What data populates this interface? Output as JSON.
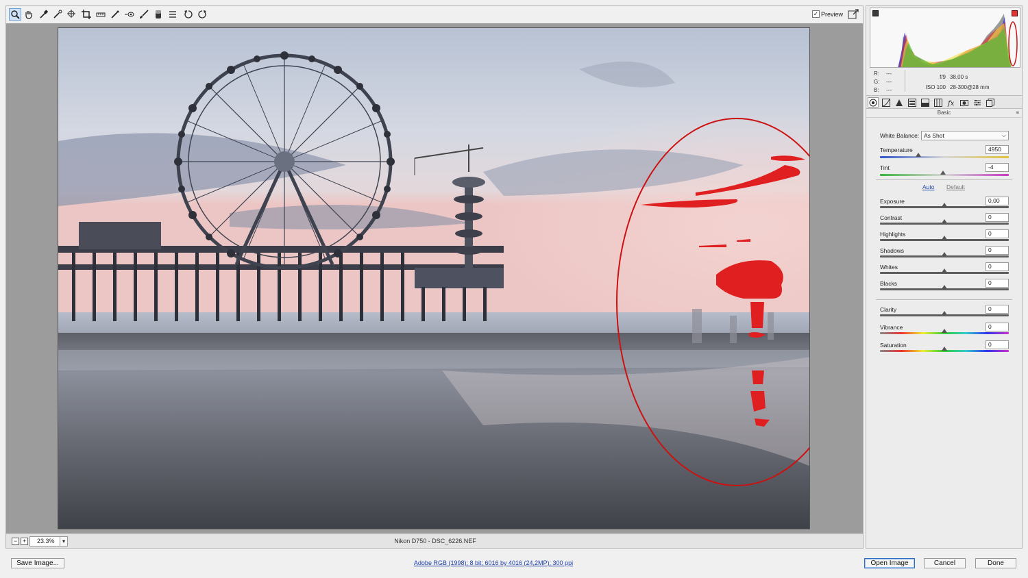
{
  "toolbar": {
    "tools": [
      {
        "name": "zoom-tool-icon",
        "active": true
      },
      {
        "name": "hand-tool-icon"
      },
      {
        "name": "white-balance-tool-icon"
      },
      {
        "name": "color-sampler-tool-icon"
      },
      {
        "name": "targeted-adjustment-tool-icon"
      },
      {
        "name": "crop-tool-icon"
      },
      {
        "name": "straighten-tool-icon"
      },
      {
        "name": "spot-removal-tool-icon"
      },
      {
        "name": "red-eye-removal-tool-icon"
      },
      {
        "name": "adjustment-brush-icon"
      },
      {
        "name": "graduated-filter-icon"
      },
      {
        "name": "radial-filter-icon"
      },
      {
        "name": "preferences-icon"
      },
      {
        "name": "rotate-left-icon"
      },
      {
        "name": "rotate-right-icon"
      }
    ],
    "preview_label": "Preview",
    "preview_checked": true
  },
  "status": {
    "zoom": "23.3%",
    "filename": "Nikon D750  -  DSC_6226.NEF"
  },
  "readout": {
    "r_label": "R:",
    "r_value": "---",
    "g_label": "G:",
    "g_value": "---",
    "b_label": "B:",
    "b_value": "---",
    "aperture": "f/9",
    "shutter": "38,00 s",
    "iso": "ISO 100",
    "lens": "28-300@28 mm"
  },
  "panel": {
    "title": "Basic",
    "menu_glyph": "≡",
    "white_balance_label": "White Balance:",
    "white_balance_value": "As Shot",
    "temperature_label": "Temperature",
    "temperature_value": "4950",
    "tint_label": "Tint",
    "tint_value": "-4",
    "auto_label": "Auto",
    "default_label": "Default",
    "sliders_tone": [
      {
        "label": "Exposure",
        "value": "0,00"
      },
      {
        "label": "Contrast",
        "value": "0"
      },
      {
        "label": "Highlights",
        "value": "0"
      },
      {
        "label": "Shadows",
        "value": "0"
      },
      {
        "label": "Whites",
        "value": "0"
      },
      {
        "label": "Blacks",
        "value": "0"
      }
    ],
    "sliders_presence": [
      {
        "label": "Clarity",
        "value": "0"
      },
      {
        "label": "Vibrance",
        "value": "0"
      },
      {
        "label": "Saturation",
        "value": "0"
      }
    ],
    "temperature_position": 0.3,
    "tint_position": 0.49,
    "tone_position": 0.5,
    "presence_position": 0.5
  },
  "footer": {
    "save_label": "Save Image...",
    "workflow_label": "Adobe RGB (1998); 8 bit; 6016 by 4016 (24,2MP); 300 ppi",
    "open_label": "Open Image",
    "cancel_label": "Cancel",
    "done_label": "Done"
  },
  "colors": {
    "clip_warning": "#e02020",
    "annotation": "#cc1111",
    "link": "#1f3fa8"
  }
}
